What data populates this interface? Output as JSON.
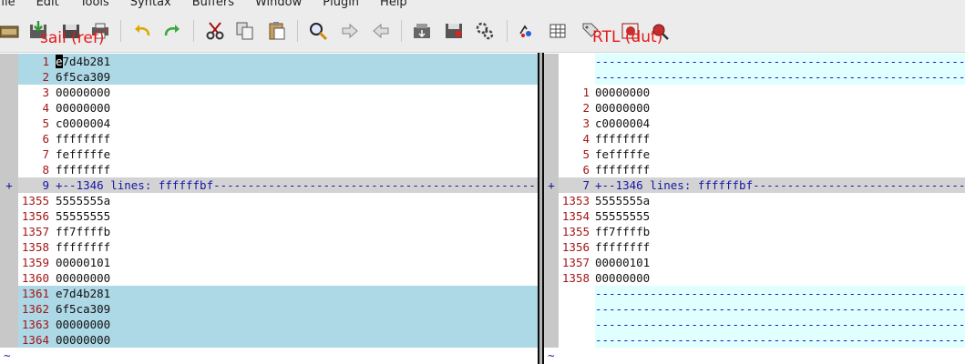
{
  "menu": [
    "rile",
    "Edit",
    "Tools",
    "Syntax",
    "Buffers",
    "Window",
    "Plugin",
    "Help"
  ],
  "toolbar": {
    "left_label": "sail (ref)",
    "right_label": "RTL (dut)",
    "icons": [
      "open-icon",
      "save-icon",
      "save-all-icon",
      "print-icon",
      "undo-icon",
      "redo-icon",
      "cut-icon",
      "copy-icon",
      "paste-icon",
      "find-replace-icon",
      "find-next-icon",
      "find-prev-icon",
      "load-session-icon",
      "save-session-icon",
      "run-script-icon",
      "make-icon",
      "shell-icon",
      "tags-icon",
      "help-icon",
      "find-help-icon"
    ]
  },
  "left_pane": {
    "rows": [
      {
        "num": "1",
        "text": "e7d4b281",
        "style": "hl",
        "cursor": true
      },
      {
        "num": "2",
        "text": "6f5ca309",
        "style": "hl"
      },
      {
        "num": "3",
        "text": "00000000"
      },
      {
        "num": "4",
        "text": "00000000"
      },
      {
        "num": "5",
        "text": "c0000004"
      },
      {
        "num": "6",
        "text": "ffffffff"
      },
      {
        "num": "7",
        "text": "fefffffe"
      },
      {
        "num": "8",
        "text": "ffffffff"
      },
      {
        "num": "9",
        "text": "+--1346 lines: ffffffbf----------------------------------------------------",
        "style": "fold",
        "sign": "+"
      },
      {
        "num": "1355",
        "text": "5555555a"
      },
      {
        "num": "1356",
        "text": "55555555"
      },
      {
        "num": "1357",
        "text": "ff7ffffb"
      },
      {
        "num": "1358",
        "text": "ffffffff"
      },
      {
        "num": "1359",
        "text": "00000101"
      },
      {
        "num": "1360",
        "text": "00000000"
      },
      {
        "num": "1361",
        "text": "e7d4b281",
        "style": "hl"
      },
      {
        "num": "1362",
        "text": "6f5ca309",
        "style": "hl"
      },
      {
        "num": "1363",
        "text": "00000000",
        "style": "hl"
      },
      {
        "num": "1364",
        "text": "00000000",
        "style": "hl"
      },
      {
        "num": "",
        "text": "~",
        "style": "tilde"
      }
    ]
  },
  "right_pane": {
    "rows": [
      {
        "num": "",
        "text": "---------------------------------------------------------",
        "style": "filler"
      },
      {
        "num": "",
        "text": "---------------------------------------------------------",
        "style": "filler"
      },
      {
        "num": "1",
        "text": "00000000"
      },
      {
        "num": "2",
        "text": "00000000"
      },
      {
        "num": "3",
        "text": "c0000004"
      },
      {
        "num": "4",
        "text": "ffffffff"
      },
      {
        "num": "5",
        "text": "fefffffe"
      },
      {
        "num": "6",
        "text": "ffffffff"
      },
      {
        "num": "7",
        "text": "+--1346 lines: ffffffbf----------------------------------------------------",
        "style": "fold",
        "sign": "+"
      },
      {
        "num": "1353",
        "text": "5555555a"
      },
      {
        "num": "1354",
        "text": "55555555"
      },
      {
        "num": "1355",
        "text": "ff7ffffb"
      },
      {
        "num": "1356",
        "text": "ffffffff"
      },
      {
        "num": "1357",
        "text": "00000101"
      },
      {
        "num": "1358",
        "text": "00000000"
      },
      {
        "num": "",
        "text": "---------------------------------------------------------",
        "style": "filler"
      },
      {
        "num": "",
        "text": "---------------------------------------------------------",
        "style": "filler"
      },
      {
        "num": "",
        "text": "---------------------------------------------------------",
        "style": "filler"
      },
      {
        "num": "",
        "text": "---------------------------------------------------------",
        "style": "filler"
      },
      {
        "num": "",
        "text": "~",
        "style": "tilde"
      }
    ]
  }
}
